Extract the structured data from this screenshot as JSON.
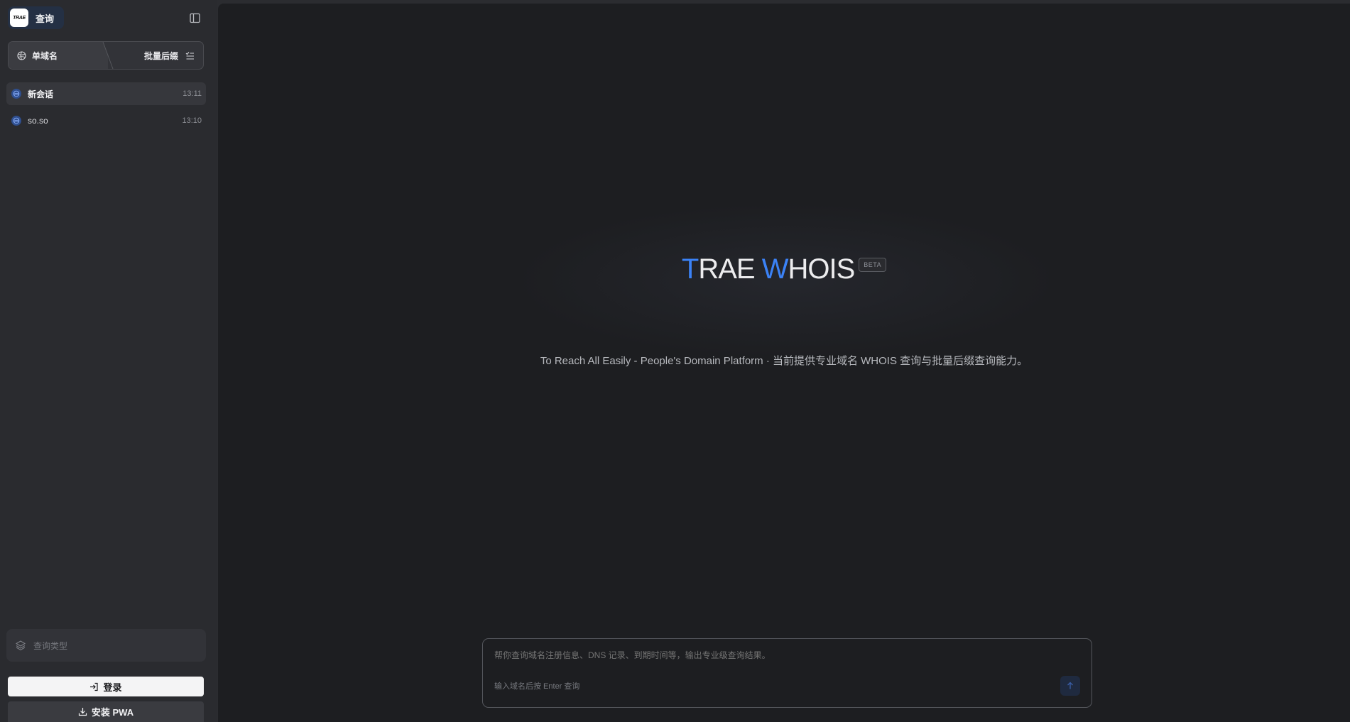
{
  "sidebar": {
    "brand": {
      "logo_text": "TRAE",
      "label": "查询"
    },
    "mode_switch": {
      "single": "单域名",
      "batch": "批量后缀"
    },
    "conversations": [
      {
        "title": "新会话",
        "time": "13:11"
      },
      {
        "title": "so.so",
        "time": "13:10"
      }
    ],
    "query_type_placeholder": "查询类型",
    "login_label": "登录",
    "pwa_label": "安装 PWA"
  },
  "hero": {
    "title_t": "T",
    "title_rae": "RAE ",
    "title_w": "W",
    "title_hois": "HOIS",
    "badge": "BETA",
    "subtitle": "To Reach All Easily - People's Domain Platform · 当前提供专业域名 WHOIS 查询与批量后缀查询能力。"
  },
  "composer": {
    "placeholder": "帮你查询域名注册信息、DNS 记录、到期时间等，输出专业级查询结果。",
    "hint": "输入域名后按 Enter 查询"
  },
  "colors": {
    "accent": "#3b82f6",
    "background": "#1d1e21",
    "sidebar": "#2a2b2f"
  }
}
